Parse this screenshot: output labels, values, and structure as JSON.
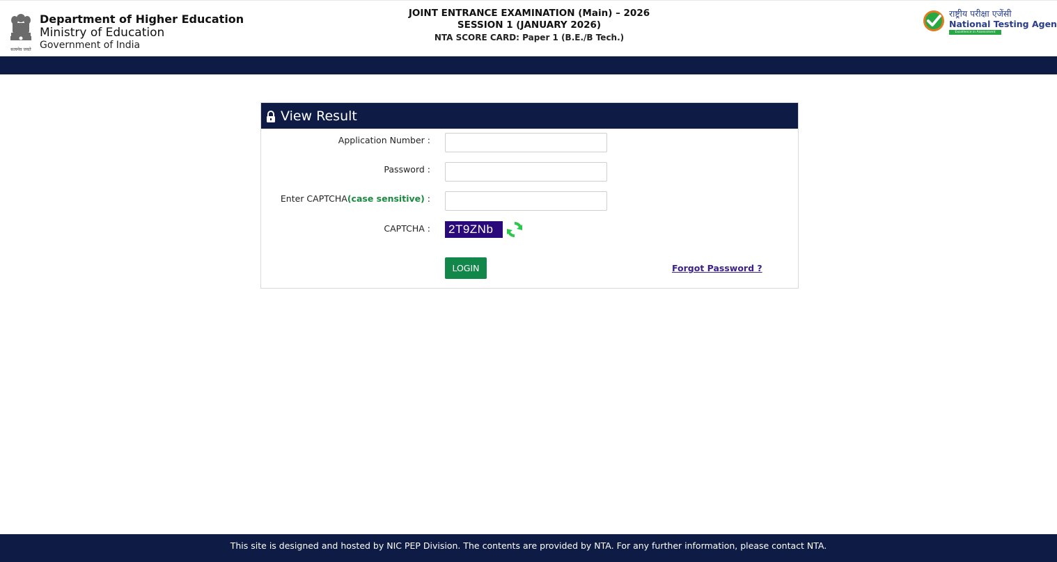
{
  "header": {
    "emblem_motto": "सत्यमेव जयते",
    "dept_line1": "Department of Higher Education",
    "dept_line2": "Ministry of Education",
    "dept_line3": "Government of India",
    "exam_title": "JOINT ENTRANCE EXAMINATION (Main) – 2026",
    "session": "SESSION 1 (JANUARY 2026)",
    "scorecard": "NTA SCORE CARD: Paper 1 (B.E./B Tech.)",
    "nta_hindi": "राष्ट्रीय परीक्षा एजेंसी",
    "nta_english": "National Testing Agency",
    "nta_tagline": "Excellence in Assessment"
  },
  "panel": {
    "title": "View Result",
    "application_label": "Application Number :",
    "application_value": "",
    "password_label": "Password :",
    "password_value": "",
    "captcha_input_label": "Enter CAPTCHA",
    "captcha_case_note": "(case sensitive)",
    "captcha_input_suffix": " :",
    "captcha_input_value": "",
    "captcha_label": "CAPTCHA :",
    "captcha_text": "2T9ZNb",
    "login_label": "LOGIN",
    "forgot_label": "Forgot Password ?"
  },
  "footer": {
    "text": "This site is designed and hosted by NIC PEP Division. The contents are provided by NTA. For any further information, please contact NTA."
  },
  "icons": {
    "emblem": "national-emblem-icon",
    "lock": "lock-icon",
    "refresh": "refresh-icon",
    "nta_logo": "nta-check-logo-icon"
  },
  "colors": {
    "navy": "#0d1b45",
    "login_green": "#12874a",
    "captcha_bg": "#2a0a7a",
    "case_note_green": "#1a8a3f",
    "nta_blue": "#2a3e8c",
    "forgot_link": "#3a1e8c"
  }
}
